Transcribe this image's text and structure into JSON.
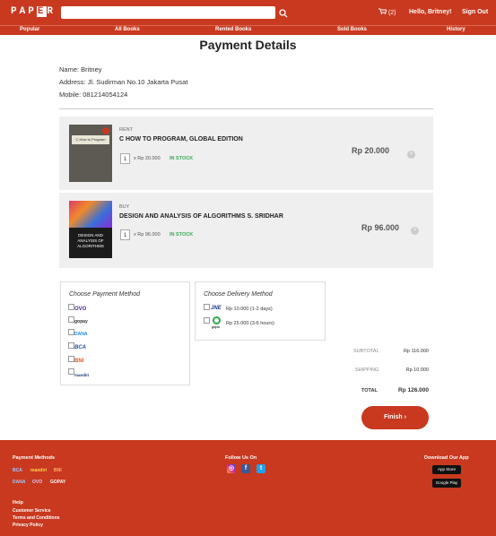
{
  "header": {
    "logo": "PAPER",
    "search_placeholder": "",
    "cart_count": "(2)",
    "greeting": "Hello, Britney!",
    "signout": "Sign Out"
  },
  "nav": [
    "Popular",
    "All Books",
    "Rented Books",
    "Sold Books",
    "History"
  ],
  "page_title": "Payment Details",
  "customer": {
    "name": "Name: Britney",
    "address": "Address: Jl. Sudirman No.10 Jakarta Pusat",
    "mobile": "Mobile: 081214054124"
  },
  "items": [
    {
      "type": "RENT",
      "title": "C HOW TO PROGRAM, GLOBAL EDITION",
      "qty": "1",
      "unit_price": "x Rp 20.000",
      "stock": "IN STOCK",
      "price": "Rp 20.000",
      "cover_text": "C How to Program"
    },
    {
      "type": "BUY",
      "title": "DESIGN AND ANALYSIS OF ALGORITHMS S. SRIDHAR",
      "qty": "1",
      "unit_price": "x Rp 96.000",
      "stock": "IN STOCK",
      "price": "Rp 96.000",
      "cover_text": "DESIGN AND ANALYSIS OF ALGORITHMS"
    }
  ],
  "payment": {
    "title": "Choose Payment Method",
    "methods": [
      "OVO",
      "gopay",
      "DANA",
      "BCA",
      "BNI",
      "mandiri"
    ]
  },
  "delivery": {
    "title": "Choose Delivery Method",
    "options": [
      {
        "logo": "JNE",
        "text": "Rp 10.000 (1-2 days)"
      },
      {
        "logo": "gojek",
        "text": "Rp 25.000 (3-6 hours)"
      }
    ]
  },
  "summary": {
    "subtotal_label": "SUBTOTAL",
    "subtotal": "Rp 116.000",
    "shipping_label": "SHIPPING",
    "shipping": "Rp 10.000",
    "total_label": "TOTAL",
    "total": "Rp 126.000"
  },
  "finish_label": "Finish",
  "footer": {
    "payment_methods": "Payment Methods",
    "pm_logos": [
      "BCA",
      "mandiri",
      "BNI",
      "DANA",
      "OVO",
      "GOPAY"
    ],
    "follow": "Follow Us On",
    "download": "Download Our App",
    "app_store": "App Store",
    "google_play": "Google Play",
    "help": "Help",
    "links": [
      "Customer Service",
      "Terms and Conditions",
      "Privacy Policy"
    ]
  },
  "colors": {
    "brand": "#c8391f",
    "in_stock": "#3aa856"
  }
}
